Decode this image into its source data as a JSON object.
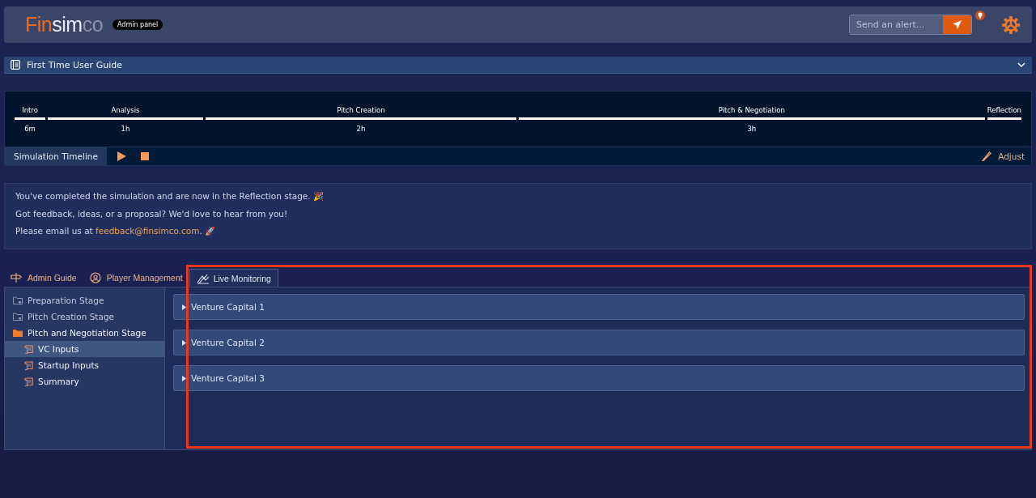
{
  "header": {
    "logo": {
      "part_1": "Fin",
      "part_2": "sim",
      "part_3": "co"
    },
    "badge": "Admin panel",
    "alert_field": {
      "placeholder": "Send an alert..."
    }
  },
  "guide": {
    "title": "First Time User Guide",
    "expanded": false
  },
  "timeline": {
    "stages": [
      {
        "label": "Intro",
        "duration": "6m"
      },
      {
        "label": "Analysis",
        "duration": "1h"
      },
      {
        "label": "Pitch Creation",
        "duration": "2h"
      },
      {
        "label": "Pitch & Negotiation",
        "duration": "3h"
      },
      {
        "label": "Reflection"
      }
    ],
    "title": "Simulation Timeline",
    "adjust": "Adjust"
  },
  "message": {
    "lines": [
      "You've completed the simulation and are now in the Reflection stage. 🎉",
      "Got feedback, ideas, or a proposal? We'd love to hear from you!"
    ],
    "email_prefix": "Please email us at ",
    "email": "feedback@finsimco.com",
    "email_suffix": ". 🚀"
  },
  "tabs": [
    {
      "label": "Admin Guide",
      "selected": false
    },
    {
      "label": "Player Management",
      "selected": false
    },
    {
      "label": "Live Monitoring",
      "selected": true
    }
  ],
  "sidebar": {
    "items": [
      {
        "label": "Preparation Stage",
        "expanded": false,
        "selected": false
      },
      {
        "label": "Pitch Creation Stage",
        "expanded": false,
        "selected": false
      },
      {
        "label": "Pitch and Negotiation Stage",
        "expanded": true,
        "selected": false,
        "children": [
          {
            "label": "VC Inputs",
            "selected": true
          },
          {
            "label": "Startup Inputs",
            "selected": false
          },
          {
            "label": "Summary",
            "selected": false
          }
        ]
      }
    ]
  },
  "panels": [
    {
      "title": "Venture Capital 1",
      "expanded": false
    },
    {
      "title": "Venture Capital 2",
      "expanded": false
    },
    {
      "title": "Venture Capital 3",
      "expanded": false
    }
  ]
}
